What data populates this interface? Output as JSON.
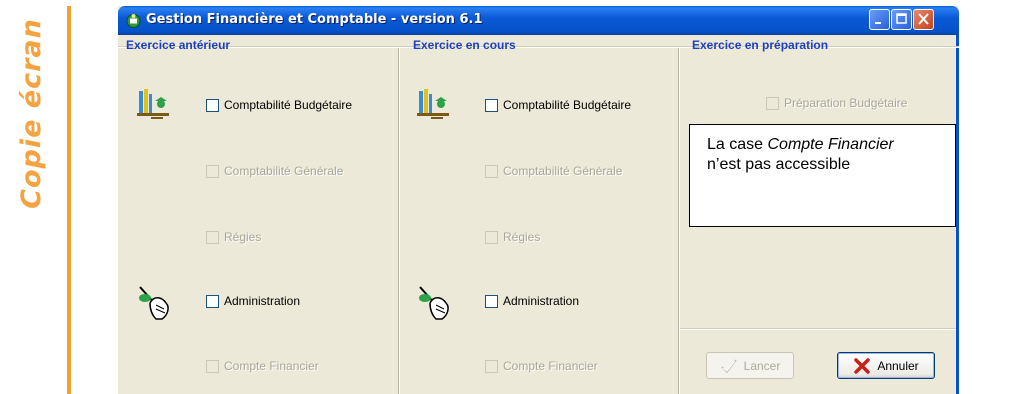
{
  "side_caption": "Copie écran",
  "window": {
    "title": "Gestion Financière et Comptable - version 6.1"
  },
  "columns": [
    {
      "title": "Exercice antérieur",
      "options": [
        {
          "label": "Comptabilité Budgétaire",
          "enabled": true
        },
        {
          "label": "Comptabilité Générale",
          "enabled": false
        },
        {
          "label": "Régies",
          "enabled": false
        },
        {
          "label": "Administration",
          "enabled": true
        },
        {
          "label": "Compte Financier",
          "enabled": false
        }
      ]
    },
    {
      "title": "Exercice en cours",
      "options": [
        {
          "label": "Comptabilité Budgétaire",
          "enabled": true
        },
        {
          "label": "Comptabilité Générale",
          "enabled": false
        },
        {
          "label": "Régies",
          "enabled": false
        },
        {
          "label": "Administration",
          "enabled": true
        },
        {
          "label": "Compte Financier",
          "enabled": false
        }
      ]
    },
    {
      "title": "Exercice en préparation",
      "options": [
        {
          "label": "Préparation Budgétaire",
          "enabled": false
        }
      ]
    }
  ],
  "callout": {
    "prefix": "La case ",
    "emphasis": "Compte Financier",
    "line2": "n’est pas accessible"
  },
  "buttons": {
    "launch_label": "Lancer",
    "cancel_label": "Annuler"
  },
  "colors": {
    "titlebar": "#0552c9",
    "window_bg": "#ece9d8",
    "section_title": "#1c3fbd",
    "side_accent": "#f0a030"
  },
  "icons": [
    "app-logo-icon",
    "budget-scale-icon",
    "admin-hand-icon",
    "checkmark-icon",
    "red-x-icon"
  ]
}
